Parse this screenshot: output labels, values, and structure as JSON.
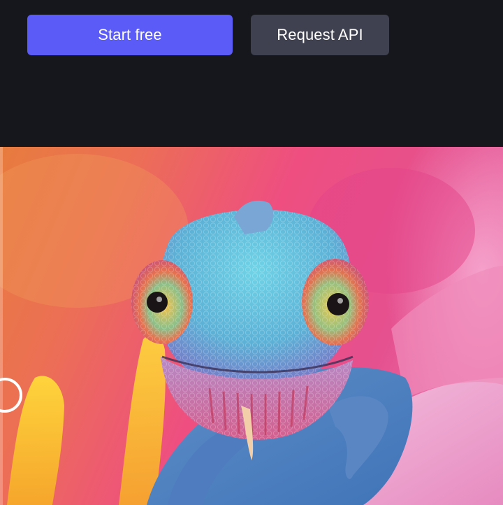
{
  "actions": {
    "start_label": "Start free",
    "api_label": "Request API"
  },
  "hero": {
    "image_icon": "chameleon-photo",
    "compare_handle_icon": "slider-handle-icon"
  },
  "colors": {
    "background": "#16171c",
    "primary_button": "#5b5bf7",
    "secondary_button": "#3f4150",
    "button_text": "#ffffff"
  }
}
